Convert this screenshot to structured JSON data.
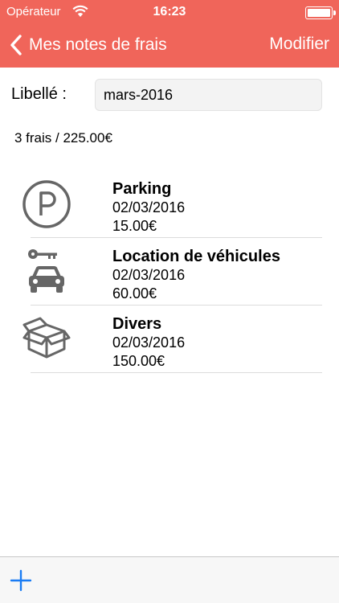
{
  "status_bar": {
    "carrier": "Opérateur",
    "time": "16:23"
  },
  "nav": {
    "back_label": "Mes notes de frais",
    "edit_label": "Modifier"
  },
  "form": {
    "label": "Libellé :",
    "value": "mars-2016"
  },
  "summary": "3 frais / 225.00€",
  "expenses": [
    {
      "icon": "parking-icon",
      "title": "Parking",
      "date": "02/03/2016",
      "amount": "15.00€"
    },
    {
      "icon": "car-rental-icon",
      "title": "Location de véhicules",
      "date": "02/03/2016",
      "amount": "60.00€"
    },
    {
      "icon": "box-icon",
      "title": "Divers",
      "date": "02/03/2016",
      "amount": "150.00€"
    }
  ],
  "colors": {
    "nav_background": "#f0655a",
    "tint_blue": "#1a7cf4",
    "icon_gray": "#666666"
  }
}
